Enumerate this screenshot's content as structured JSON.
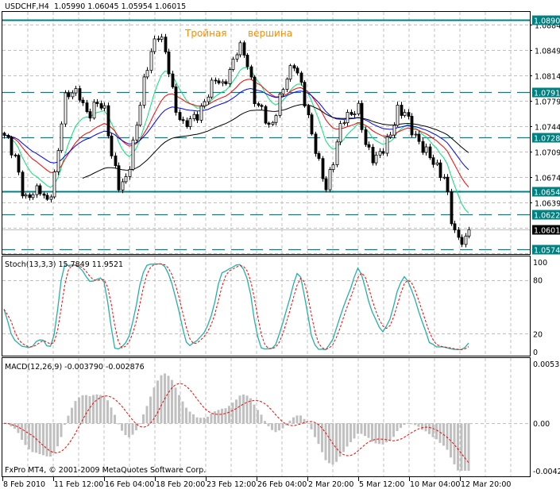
{
  "chart_data": {
    "type": "candlestick",
    "title": "USDCHF,H4",
    "ohlc_header": "1.05990 1.06045 1.05954 1.06015",
    "annotations": [
      "Тройная",
      "вершина"
    ],
    "copyright": "FxPro MT4, © 2001-2009 MetaQuotes Software Corp.",
    "close_waypoints": [
      1.0738,
      1.0725,
      1.07,
      1.064,
      1.0648,
      1.0655,
      1.064,
      1.069,
      1.078,
      1.0788,
      1.0785,
      1.076,
      1.078,
      1.077,
      1.07,
      1.0658,
      1.068,
      1.074,
      1.08,
      1.0845,
      1.0875,
      1.084,
      1.077,
      1.0742,
      1.075,
      1.0762,
      1.079,
      1.0812,
      1.0795,
      1.082,
      1.086,
      1.084,
      1.078,
      1.076,
      1.0735,
      1.078,
      1.0815,
      1.083,
      1.079,
      1.074,
      1.07,
      1.0662,
      1.07,
      1.075,
      1.0758,
      1.0775,
      1.072,
      1.0695,
      1.0705,
      1.073,
      1.077,
      1.0765,
      1.073,
      1.0712,
      1.0705,
      1.069,
      1.0672,
      1.0595,
      1.0582,
      1.06015
    ],
    "price_axis": {
      "ticks": [
        "1.08840",
        "1.08490",
        "1.08140",
        "1.07790",
        "1.07440",
        "1.07090",
        "1.06740",
        "1.06390"
      ],
      "range": [
        1.056,
        1.0901
      ]
    },
    "levels": [
      {
        "value": "1.08904",
        "style": "solid"
      },
      {
        "value": "1.07913",
        "style": "dashed"
      },
      {
        "value": "1.07285",
        "style": "dashed"
      },
      {
        "value": "1.06541",
        "style": "solid"
      },
      {
        "value": "1.06227",
        "style": "dashed"
      },
      {
        "value": "1.05746",
        "style": "dashed"
      }
    ],
    "current_price": "1.06015",
    "moving_averages": [
      {
        "name": "fast",
        "period": 10,
        "color": "#00e676"
      },
      {
        "name": "medium",
        "period": 21,
        "color": "#ff0000"
      },
      {
        "name": "slow",
        "period": 34,
        "color": "#0000ff"
      },
      {
        "name": "long",
        "period": 60,
        "color": "#000000"
      }
    ],
    "x_labels": [
      "8 Feb 2010",
      "11 Feb 12:00",
      "16 Feb 04:00",
      "18 Feb 20:00",
      "23 Feb 12:00",
      "26 Feb 04:00",
      "2 Mar 20:00",
      "5 Mar 12:00",
      "10 Mar 04:00",
      "12 Mar 20:00"
    ],
    "stochastic": {
      "label": "Stoch(13,3,3) 15.7849 11.9521",
      "ticks": [
        "100",
        "80",
        "20",
        "0"
      ],
      "main_color": "#20b2aa",
      "signal_color": "#ff0000"
    },
    "macd": {
      "label": "MACD(12,26,9) -0.003790 -0.002876",
      "ticks": [
        "0.00532",
        "0.00",
        "-0.00423"
      ],
      "range": [
        -0.00423,
        0.00532
      ],
      "hist_color": "#c0c0c0",
      "signal_color": "#ff0000"
    }
  },
  "colors": {
    "level": "#008080",
    "annotation": "#ff8c00",
    "grid": "#c0c0c0"
  }
}
